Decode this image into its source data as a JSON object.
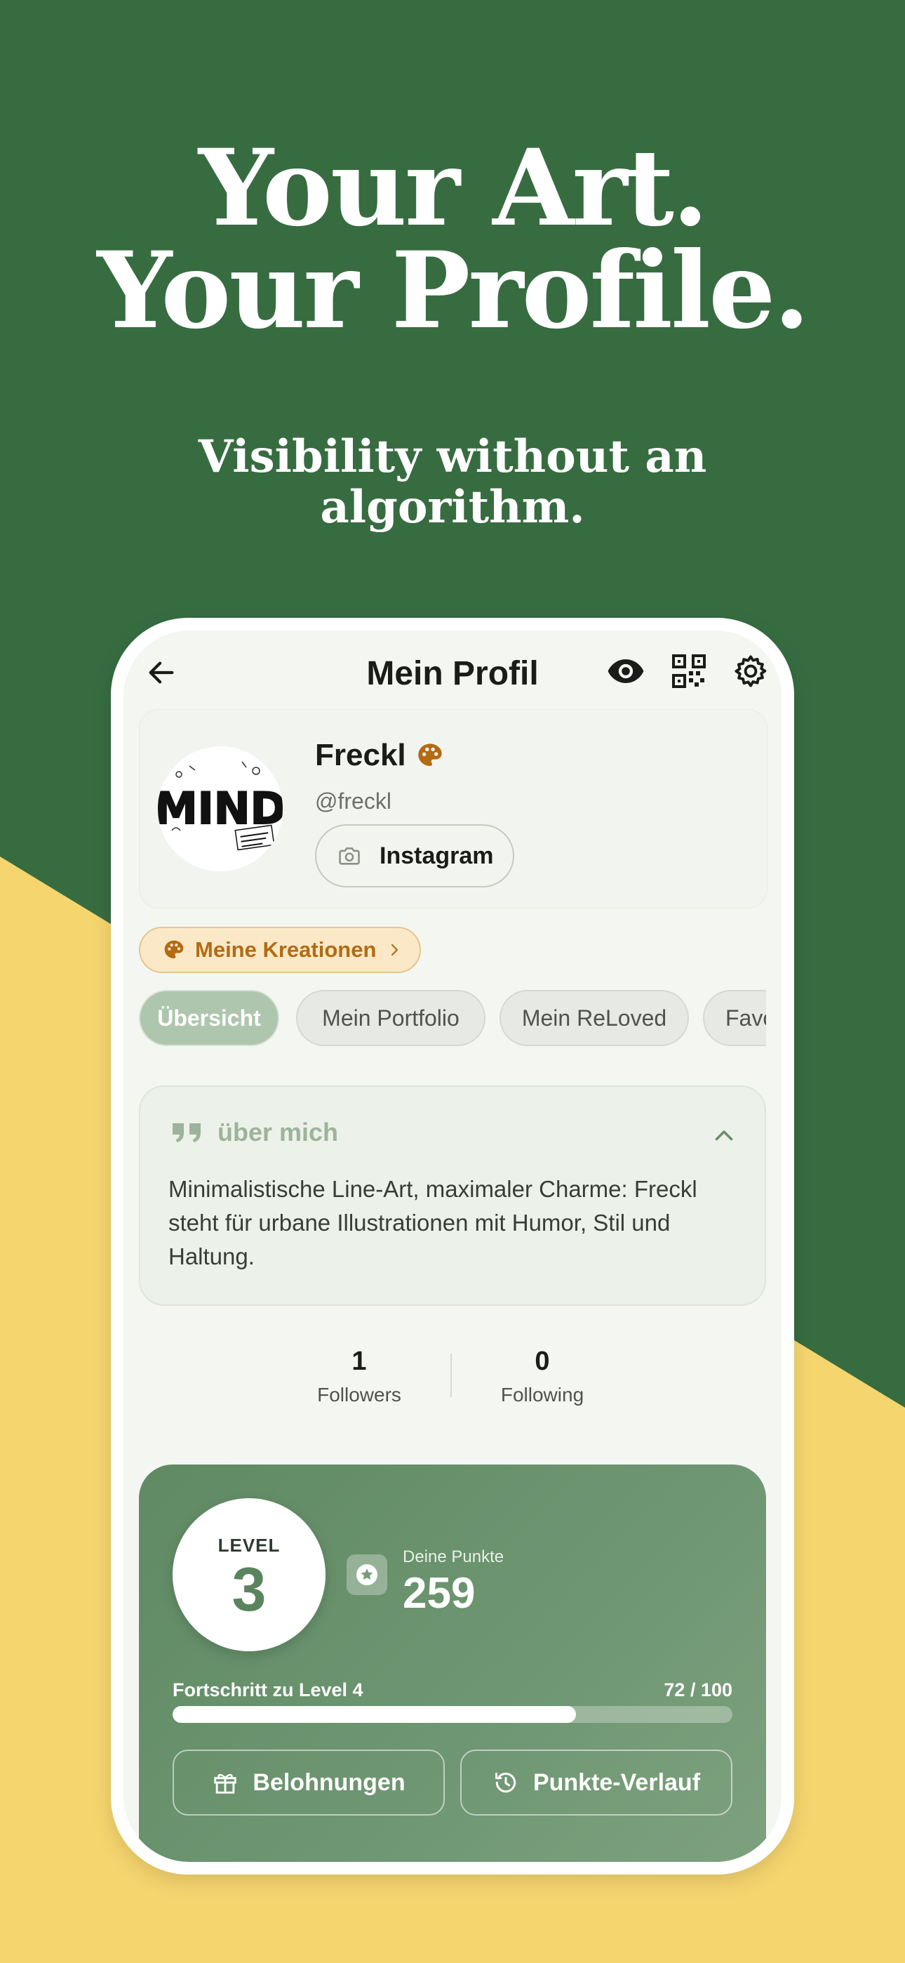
{
  "promo": {
    "headline_line1": "Your Art.",
    "headline_line2": "Your Profile.",
    "subline_line1": "Visibility without an",
    "subline_line2": "algorithm."
  },
  "colors": {
    "background_green": "#376c41",
    "background_yellow": "#f5d56e",
    "accent_green": "#5f8a63",
    "accent_orange": "#b36b12"
  },
  "topbar": {
    "title": "Mein Profil",
    "icons": [
      "back-arrow-icon",
      "eye-icon",
      "qr-code-icon",
      "gear-icon"
    ]
  },
  "profile": {
    "name": "Freckl",
    "handle": "@freckl",
    "instagram_label": "Instagram",
    "avatar_text": "MIND"
  },
  "creations_label": "Meine Kreationen",
  "tabs": [
    {
      "label": "Übersicht",
      "active": true
    },
    {
      "label": "Mein Portfolio",
      "active": false
    },
    {
      "label": "Mein ReLoved",
      "active": false
    },
    {
      "label": "Favo",
      "active": false
    }
  ],
  "about": {
    "title": "über mich",
    "text": "Minimalistische Line-Art, maximaler Charme: Freckl steht für urbane Illustrationen mit Humor, Stil und Haltung."
  },
  "stats": {
    "followers_count": "1",
    "followers_label": "Followers",
    "following_count": "0",
    "following_label": "Following"
  },
  "level": {
    "level_label": "LEVEL",
    "level_number": "3",
    "points_label": "Deine Punkte",
    "points_value": "259",
    "progress_label": "Fortschritt zu Level 4",
    "progress_value": "72 / 100",
    "progress_fraction": 0.72,
    "rewards_label": "Belohnungen",
    "history_label": "Punkte-Verlauf"
  }
}
